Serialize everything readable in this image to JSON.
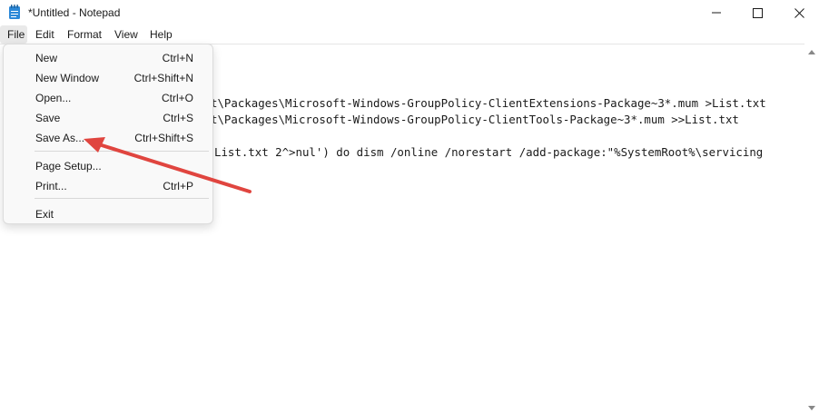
{
  "window": {
    "title": "*Untitled - Notepad",
    "icon": "notepad-icon"
  },
  "menubar": {
    "file": "File",
    "edit": "Edit",
    "format": "Format",
    "view": "View",
    "help": "Help"
  },
  "file_menu": {
    "items": [
      {
        "label": "New",
        "shortcut": "Ctrl+N"
      },
      {
        "label": "New Window",
        "shortcut": "Ctrl+Shift+N"
      },
      {
        "label": "Open...",
        "shortcut": "Ctrl+O"
      },
      {
        "label": "Save",
        "shortcut": "Ctrl+S"
      },
      {
        "label": "Save As...",
        "shortcut": "Ctrl+Shift+S"
      },
      {
        "label": "Page Setup...",
        "shortcut": ""
      },
      {
        "label": "Print...",
        "shortcut": "Ctrl+P"
      },
      {
        "label": "Exit",
        "shortcut": ""
      }
    ]
  },
  "editor": {
    "lines": [
      "t\\Packages\\Microsoft-Windows-GroupPolicy-ClientExtensions-Package~3*.mum >List.txt",
      "t\\Packages\\Microsoft-Windows-GroupPolicy-ClientTools-Package~3*.mum >>List.txt",
      "List.txt 2^>nul') do dism /online /norestart /add-package:\"%SystemRoot%\\servicing"
    ]
  },
  "colors": {
    "annotation_arrow": "#e0453f",
    "menu_background": "#f9f9f9",
    "notepad_icon": "#2b88d8"
  }
}
